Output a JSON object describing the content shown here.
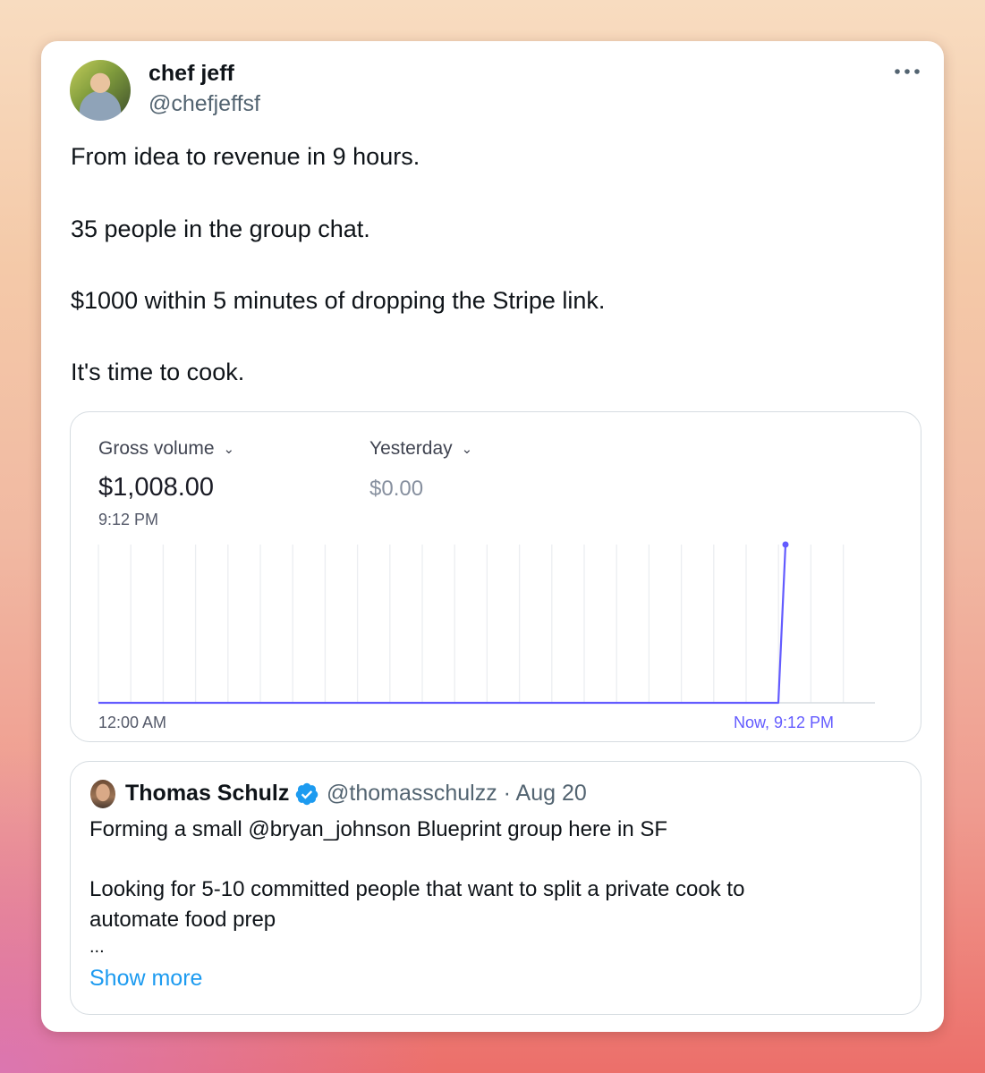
{
  "tweet": {
    "author": {
      "name": "chef jeff",
      "handle": "@chefjeffsf"
    },
    "more_icon": "more-horizontal-icon",
    "paragraphs": [
      "From idea to revenue in 9 hours.",
      "35 people in the group chat.",
      "$1000 within 5 minutes of dropping the Stripe link.",
      "It's time to cook."
    ]
  },
  "stripe_widget": {
    "primary_metric": {
      "label": "Gross volume",
      "value": "$1,008.00",
      "time": "9:12 PM"
    },
    "comparison_metric": {
      "label": "Yesterday",
      "value": "$0.00"
    },
    "dropdown_icon": "chevron-down-icon",
    "accent_color": "#635bff"
  },
  "chart_data": {
    "type": "line",
    "x_start_label": "12:00 AM",
    "x_end_label": "Now, 9:12 PM",
    "series": [
      {
        "values": [
          0,
          0,
          0,
          0,
          0,
          0,
          0,
          0,
          0,
          0,
          0,
          0,
          0,
          0,
          0,
          0,
          0,
          0,
          0,
          0,
          0,
          1008
        ]
      }
    ],
    "ylim": [
      0,
      1008
    ],
    "grid": "vertical",
    "color": "#635bff"
  },
  "quoted_tweet": {
    "author_name": "Thomas Schulz",
    "verified_icon": "verified-badge-icon",
    "handle": "@thomasschulzz",
    "date": "Aug 20",
    "meta": "@thomasschulzz · Aug 20",
    "line1": "Forming a small @bryan_johnson Blueprint group here in SF",
    "line2": "Looking for 5-10 committed people that want to split a private cook to",
    "line3": "automate food prep",
    "ellipsis": "...",
    "show_more": "Show more",
    "link_color": "#1d9bf0"
  }
}
